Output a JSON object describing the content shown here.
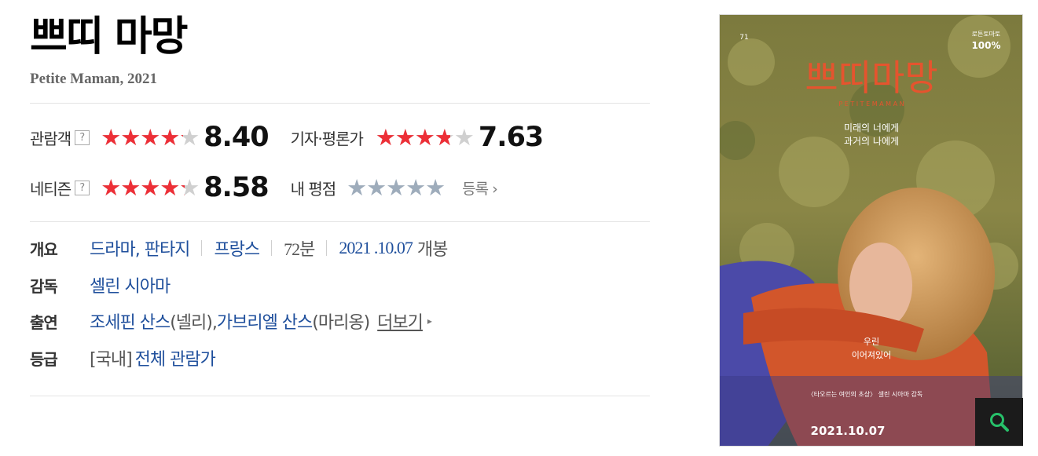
{
  "movie": {
    "title": "쁘띠 마망",
    "subtitle": "Petite Maman, 2021"
  },
  "ratings": {
    "audience": {
      "label": "관람객",
      "help": "?",
      "score": "8.40",
      "fill_percent": 84
    },
    "critics": {
      "label": "기자·평론가",
      "score": "7.63",
      "fill_percent": 76.3
    },
    "netizen": {
      "label": "네티즌",
      "help": "?",
      "score": "8.58",
      "fill_percent": 85.8
    },
    "mine": {
      "label": "내 평점",
      "register_label": "등록",
      "register_arrow": "›",
      "fill_percent": 0
    },
    "star_glyphs": "★★★★★",
    "star_color": "#ed2f37",
    "empty_star_color": "#d0d0d0",
    "my_star_color": "#9eacbb"
  },
  "info": {
    "overview": {
      "label": "개요",
      "genres": "드라마, 판타지",
      "country": "프랑스",
      "runtime": "72분",
      "release_date": "2021 .10.07",
      "release_suffix": "개봉"
    },
    "director": {
      "label": "감독",
      "name": "셀린 시아마"
    },
    "cast": {
      "label": "출연",
      "actor1": "조세핀 산스",
      "role1": "(넬리), ",
      "actor2": "가브리엘 산스",
      "role2": "(마리옹)",
      "more_label": "더보기",
      "more_arrow": "▸"
    },
    "grade": {
      "label": "등급",
      "region": "[국내]",
      "value": "전체 관람가"
    }
  },
  "poster": {
    "title_art": "쁘띠마망",
    "subtitle_art": "P E T I T E   M A M A N",
    "tagline1": "미래의 너에게",
    "tagline2": "과거의 나에게",
    "badge_label": "로튼토마토",
    "badge_value": "100%",
    "fest_number": "71",
    "middle1": "우린",
    "middle2": "이어져있어",
    "credit": "〈타오르는 여인의 초상〉 셀린 시아마 감독",
    "date": "2021.10.07",
    "zoom_icon": "search-icon"
  }
}
